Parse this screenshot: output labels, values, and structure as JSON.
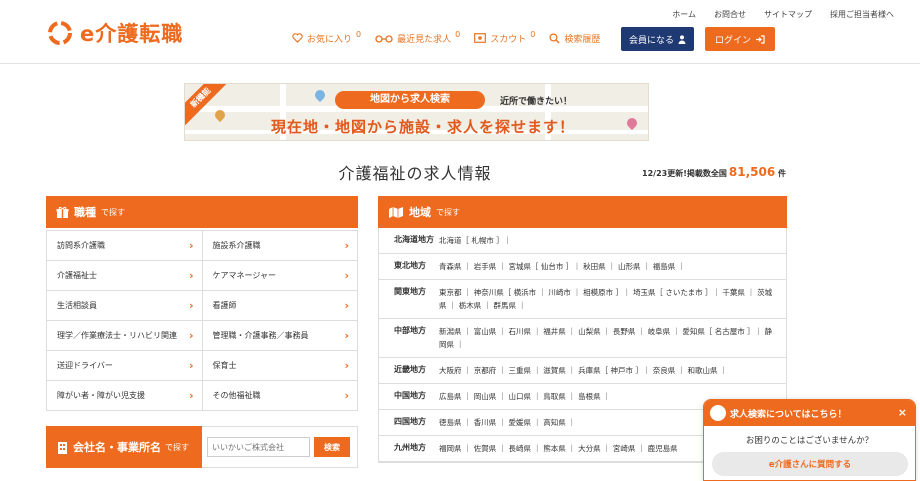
{
  "brand": {
    "name": "e介護転職",
    "accent": "#ee6a1e",
    "navy": "#1f3a73"
  },
  "top_links": [
    "ホーム",
    "お問合せ",
    "サイトマップ",
    "採用ご担当者様へ"
  ],
  "nav": [
    {
      "label": "お気に入り",
      "count": "0",
      "icon": "heart-icon"
    },
    {
      "label": "最近見た求人",
      "count": "0",
      "icon": "glasses-icon"
    },
    {
      "label": "スカウト",
      "count": "0",
      "icon": "mail-icon"
    },
    {
      "label": "検索履歴",
      "count": "",
      "icon": "search-icon"
    }
  ],
  "buttons": {
    "member": "会員になる",
    "login": "ログイン"
  },
  "banner": {
    "corner": "新機能",
    "pill": "地図から求人検索",
    "bubble": "近所で働きたい！",
    "main": "現在地・地図から施設・求人を探せます！"
  },
  "page": {
    "title": "介護福祉の求人情報",
    "stats_prefix": "12/23更新!掲載数全国",
    "stats_count": "81,506",
    "stats_suffix": "件"
  },
  "job_panel": {
    "title": "職種",
    "suffix": "で探す",
    "items": [
      [
        "訪問系介護職",
        "施設系介護職"
      ],
      [
        "介護福祉士",
        "ケアマネージャー"
      ],
      [
        "生活相談員",
        "看護師"
      ],
      [
        "理学／作業療法士・リハビリ関連",
        "管理職・介護事務／事務員"
      ],
      [
        "送迎ドライバー",
        "保育士"
      ],
      [
        "障がい者・障がい児支援",
        "その他福祉職"
      ]
    ]
  },
  "company_search": {
    "title": "会社名・事業所名",
    "suffix": "で探す",
    "placeholder": "いいかいご株式会社",
    "button": "検索"
  },
  "region_panel": {
    "title": "地域",
    "suffix": "で探す",
    "rows": [
      {
        "name": "北海道地方",
        "prefs": "北海道［ 札幌市 ］｜"
      },
      {
        "name": "東北地方",
        "prefs": "青森県 ｜ 岩手県 ｜ 宮城県［ 仙台市 ］｜ 秋田県 ｜ 山形県 ｜ 福島県 ｜"
      },
      {
        "name": "関東地方",
        "prefs": "東京都 ｜ 神奈川県［ 横浜市 ｜ 川崎市 ｜ 相模原市 ］｜ 埼玉県［ さいたま市 ］｜ 千葉県 ｜ 茨城県 ｜ 栃木県 ｜ 群馬県 ｜"
      },
      {
        "name": "中部地方",
        "prefs": "新潟県 ｜ 富山県 ｜ 石川県 ｜ 福井県 ｜ 山梨県 ｜ 長野県 ｜ 岐阜県 ｜ 愛知県［ 名古屋市 ］｜ 静岡県 ｜"
      },
      {
        "name": "近畿地方",
        "prefs": "大阪府 ｜ 京都府 ｜ 三重県 ｜ 滋賀県 ｜ 兵庫県［ 神戸市 ］｜ 奈良県 ｜ 和歌山県 ｜"
      },
      {
        "name": "中国地方",
        "prefs": "広島県 ｜ 岡山県 ｜ 山口県 ｜ 鳥取県 ｜ 島根県 ｜"
      },
      {
        "name": "四国地方",
        "prefs": "徳島県 ｜ 香川県 ｜ 愛媛県 ｜ 高知県 ｜"
      },
      {
        "name": "九州地方",
        "prefs": "福岡県 ｜ 佐賀県 ｜ 長崎県 ｜ 熊本県 ｜ 大分県 ｜ 宮崎県 ｜ 鹿児島県"
      }
    ]
  },
  "chat": {
    "title": "求人検索についてはこちら！",
    "close": "×",
    "message": "お困りのことはございませんか？",
    "button": "e介護さんに質問する"
  }
}
